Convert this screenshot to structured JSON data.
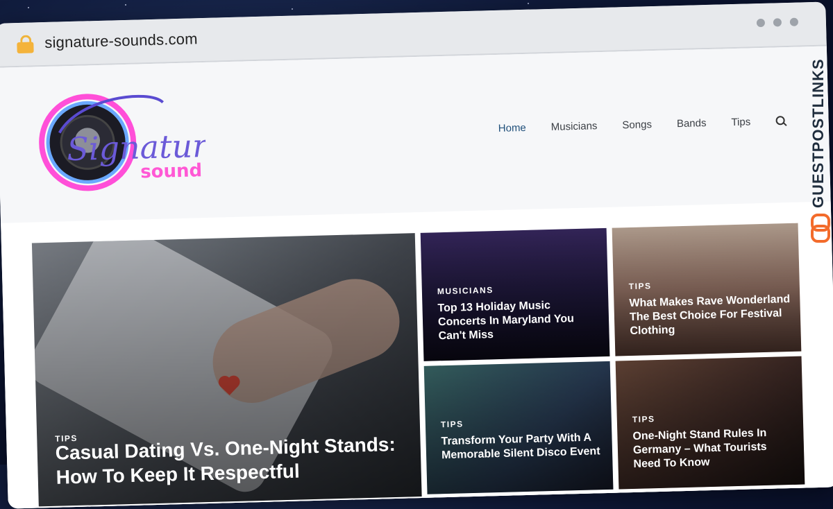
{
  "browser": {
    "url": "signature-sounds.com"
  },
  "site": {
    "logo": {
      "primary": "Signature",
      "secondary": "sound"
    },
    "nav": [
      {
        "label": "Home",
        "active": true
      },
      {
        "label": "Musicians"
      },
      {
        "label": "Songs"
      },
      {
        "label": "Bands"
      },
      {
        "label": "Tips"
      }
    ],
    "featured": {
      "category": "TIPS",
      "title": "Casual Dating Vs. One-Night Stands: How To Keep It Respectful"
    },
    "cards": [
      {
        "category": "MUSICIANS",
        "title": "Top 13 Holiday Music Concerts In Maryland You Can't Miss"
      },
      {
        "category": "TIPS",
        "title": "What Makes Rave Wonderland The Best Choice For Festival Clothing"
      },
      {
        "category": "TIPS",
        "title": "Transform Your Party With A Memorable Silent Disco Event"
      },
      {
        "category": "TIPS",
        "title": "One-Night Stand Rules In Germany – What Tourists Need To Know"
      }
    ]
  },
  "sidebar_brand": {
    "text": "GUESTPOSTLINKS",
    "accent": "#f36b2b"
  }
}
